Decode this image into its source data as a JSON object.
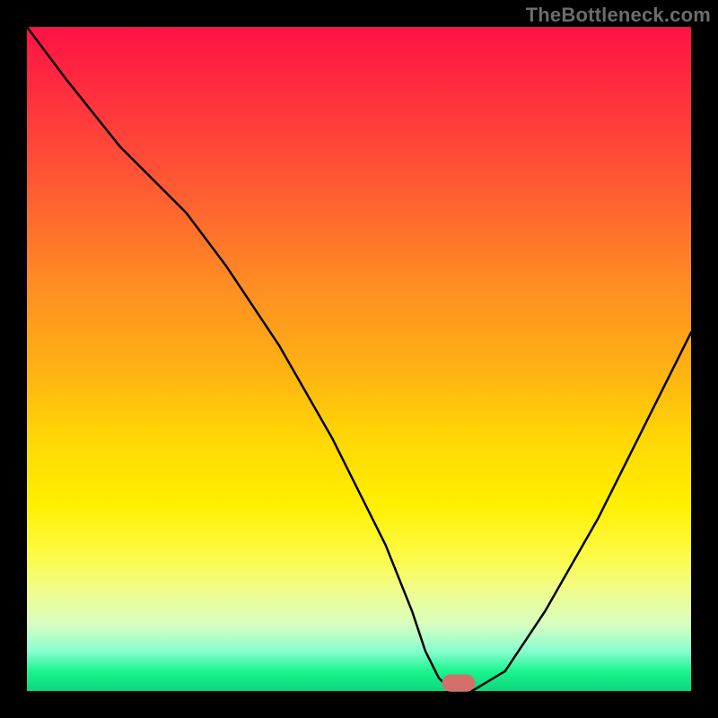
{
  "watermark": "TheBottleneck.com",
  "colors": {
    "frame": "#000000",
    "gradient_top": "#ff1245",
    "gradient_mid": "#fff000",
    "gradient_bottom": "#0ed57a",
    "curve": "#000000",
    "marker": "#d3706b"
  },
  "chart_data": {
    "type": "line",
    "title": "",
    "xlabel": "",
    "ylabel": "",
    "xlim": [
      0,
      100
    ],
    "ylim": [
      0,
      100
    ],
    "x": [
      0,
      6,
      14,
      24,
      30,
      38,
      46,
      54,
      58,
      60,
      62,
      63.5,
      65,
      67,
      72,
      78,
      86,
      94,
      100
    ],
    "values": [
      100,
      92,
      82,
      72,
      64,
      52,
      38,
      22,
      12,
      6,
      2,
      0.5,
      0,
      0,
      3,
      12,
      26,
      42,
      54
    ],
    "marker": {
      "x_center": 65,
      "y": 1.2,
      "width_x": 5,
      "height_y": 2.6
    },
    "grid": false,
    "legend": false
  }
}
